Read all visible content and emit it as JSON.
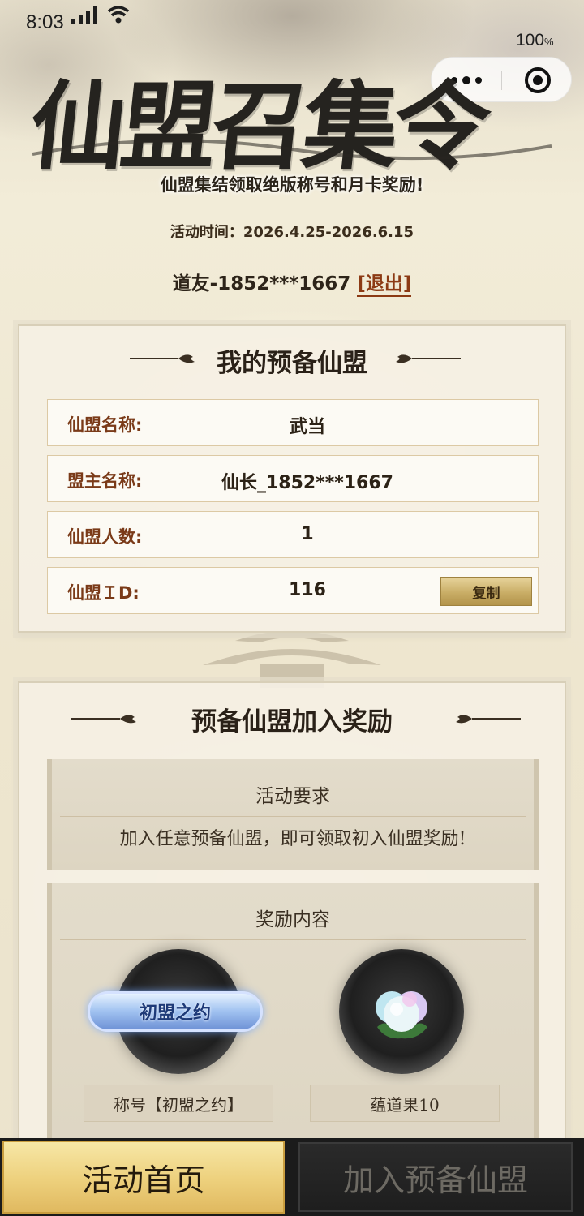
{
  "status_bar": {
    "time": "8:03",
    "battery": "100",
    "battery_unit": "%"
  },
  "capsule": {
    "more_icon": "more-dots-icon",
    "close_icon": "target-close-icon"
  },
  "header": {
    "title": "仙盟召集令",
    "subtitle": "仙盟集结领取绝版称号和月卡奖励!",
    "event_time": "活动时间：2026.4.25-2026.6.15",
    "user": "道友-1852***1667",
    "logout": "[退出]"
  },
  "my_alliance": {
    "title": "我的预备仙盟",
    "rows": [
      {
        "label": "仙盟名称:",
        "value": "武当"
      },
      {
        "label": "盟主名称:",
        "value": "仙长_1852***1667"
      },
      {
        "label": "仙盟人数:",
        "value": "1"
      },
      {
        "label": "仙盟ＩD:",
        "value": "116"
      }
    ],
    "copy_label": "复制"
  },
  "rewards": {
    "title": "预备仙盟加入奖励",
    "requirement_heading": "活动要求",
    "requirement_text": "加入任意预备仙盟，即可领取初入仙盟奖励!",
    "content_heading": "奖励内容",
    "items": [
      {
        "badge_text": "初盟之约",
        "label": "称号【初盟之约】"
      },
      {
        "label": "蕴道果10"
      }
    ]
  },
  "bottom_nav": {
    "home": "活动首页",
    "join": "加入预备仙盟"
  }
}
